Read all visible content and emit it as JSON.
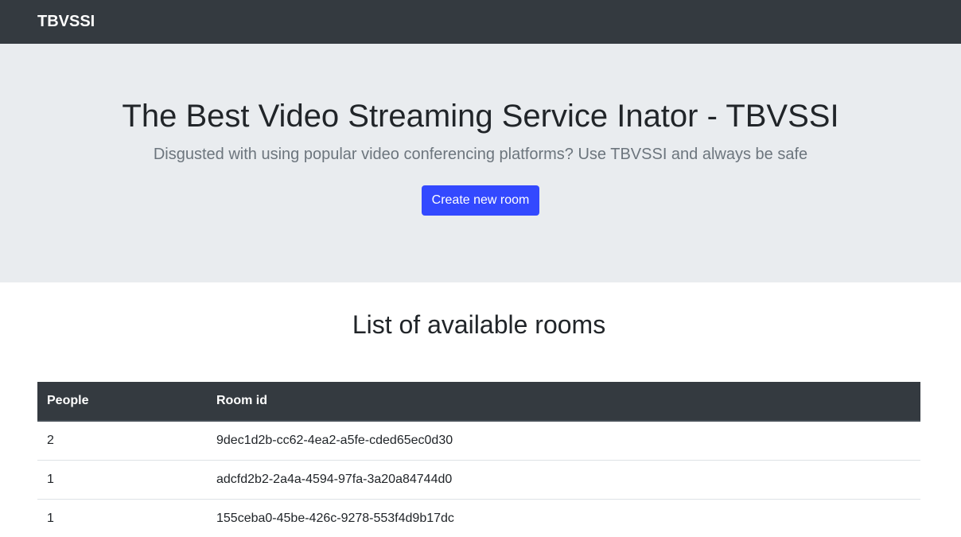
{
  "navbar": {
    "brand": "TBVSSI"
  },
  "hero": {
    "title": "The Best Video Streaming Service Inator - TBVSSI",
    "lead": "Disgusted with using popular video conferencing platforms? Use TBVSSI and always be safe",
    "create_button_label": "Create new room"
  },
  "rooms": {
    "title": "List of available rooms",
    "columns": [
      "People",
      "Room id"
    ],
    "rows": [
      {
        "people": "2",
        "room_id": "9dec1d2b-cc62-4ea2-a5fe-cded65ec0d30"
      },
      {
        "people": "1",
        "room_id": "adcfd2b2-2a4a-4594-97fa-3a20a84744d0"
      },
      {
        "people": "1",
        "room_id": "155ceba0-45be-426c-9278-553f4d9b17dc"
      }
    ]
  },
  "colors": {
    "navbar_bg": "#343a40",
    "hero_bg": "#e9ecef",
    "primary_button": "#3349ff",
    "muted_text": "#6c757d"
  }
}
